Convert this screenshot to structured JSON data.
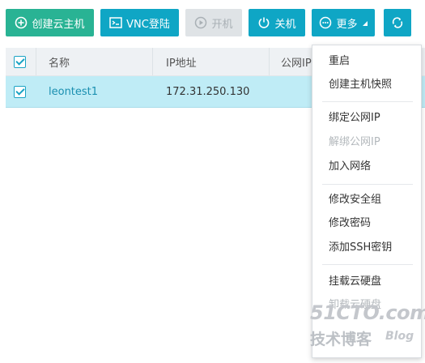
{
  "toolbar": {
    "create_label": "创建云主机",
    "vnc_label": "VNC登陆",
    "start_label": "开机",
    "shutdown_label": "关机",
    "more_label": "更多"
  },
  "table": {
    "columns": [
      "名称",
      "IP地址",
      "公网IP"
    ],
    "rows": [
      {
        "name": "leontest1",
        "ip": "172.31.250.130"
      }
    ]
  },
  "more_menu": {
    "items": [
      {
        "label": "重启",
        "disabled": false
      },
      {
        "label": "创建主机快照",
        "disabled": false
      },
      {
        "label": "绑定公网IP",
        "disabled": false
      },
      {
        "label": "解绑公网IP",
        "disabled": true
      },
      {
        "label": "加入网络",
        "disabled": false
      },
      {
        "label": "修改安全组",
        "disabled": false
      },
      {
        "label": "修改密码",
        "disabled": false
      },
      {
        "label": "添加SSH密钥",
        "disabled": false
      },
      {
        "label": "挂载云硬盘",
        "disabled": false
      },
      {
        "label": "卸载云硬盘",
        "disabled": true
      }
    ]
  },
  "watermark": {
    "site": "51CTO.com",
    "tagline": "技术博客",
    "blog": "Blog"
  },
  "colors": {
    "primary_green": "#29b394",
    "primary_blue": "#0fa6c5",
    "selected_row": "#bfecf6",
    "disabled": "#dfe3e6"
  }
}
